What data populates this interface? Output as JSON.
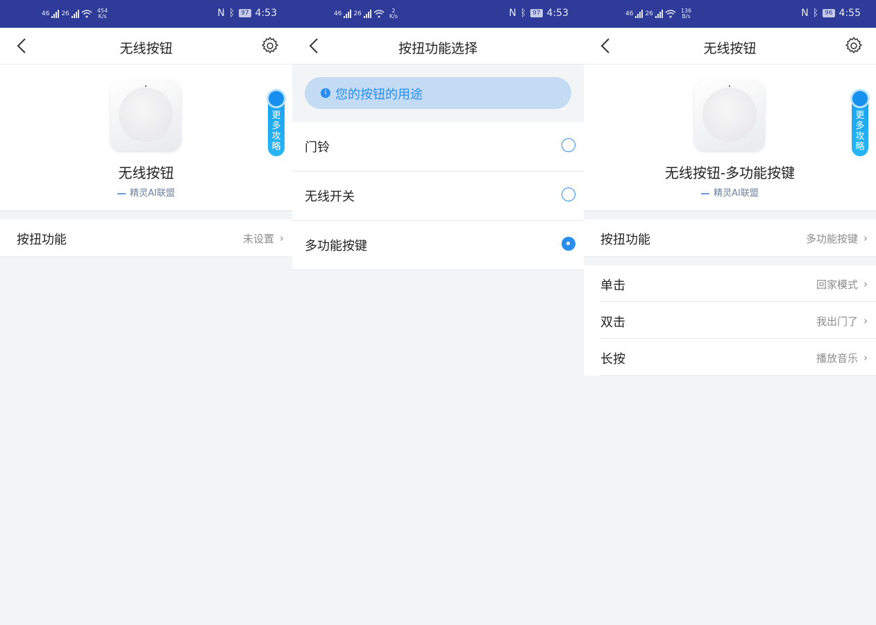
{
  "statusbars": [
    {
      "net_top": "454",
      "net_bottom": "K/s",
      "battery": "97",
      "time": "4:53",
      "sig1": "46",
      "sig2": "26"
    },
    {
      "net_top": "2",
      "net_bottom": "K/s",
      "battery": "97",
      "time": "4:53",
      "sig1": "46",
      "sig2": "26"
    },
    {
      "net_top": "136",
      "net_bottom": "B/s",
      "battery": "96",
      "time": "4:55",
      "sig1": "46",
      "sig2": "26"
    }
  ],
  "screen1": {
    "title": "无线按钮",
    "device_name": "无线按钮",
    "brand": "精灵AI联盟",
    "more_guide": "更\n多\n攻\n略",
    "row_label": "按扭功能",
    "row_value": "未设置"
  },
  "screen2": {
    "title": "按扭功能选择",
    "info": "您的按钮的用途",
    "options": [
      {
        "label": "门铃",
        "selected": false
      },
      {
        "label": "无线开关",
        "selected": false
      },
      {
        "label": "多功能按键",
        "selected": true
      }
    ]
  },
  "screen3": {
    "title": "无线按钮",
    "device_name": "无线按钮-多功能按键",
    "brand": "精灵AI联盟",
    "more_guide": "更\n多\n攻\n略",
    "row_label": "按扭功能",
    "row_value": "多功能按键",
    "actions": [
      {
        "label": "单击",
        "value": "回家模式"
      },
      {
        "label": "双击",
        "value": "我出门了"
      },
      {
        "label": "长按",
        "value": "播放音乐"
      }
    ]
  },
  "colors": {
    "status_bar": "#2f3b98",
    "accent": "#2a8ef0",
    "guide": "#1aa0ee",
    "info_bg": "#c3dcf4"
  },
  "icons": [
    "back-icon",
    "gear-icon",
    "info-icon",
    "chevron-right-icon",
    "radio-icon",
    "signal-icon",
    "wifi-icon",
    "nfc-icon",
    "bluetooth-icon",
    "battery-icon"
  ]
}
